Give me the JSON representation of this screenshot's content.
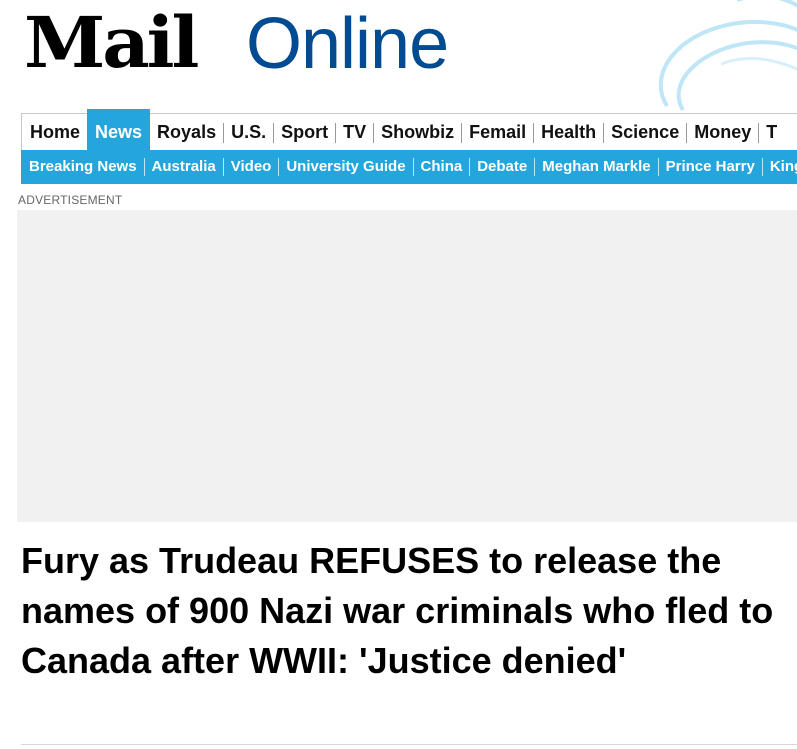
{
  "header": {
    "logo_mail": "Mail",
    "logo_online": "Online"
  },
  "nav_primary": {
    "items": [
      {
        "label": "Home",
        "active": false
      },
      {
        "label": "News",
        "active": true
      },
      {
        "label": "Royals",
        "active": false
      },
      {
        "label": "U.S.",
        "active": false
      },
      {
        "label": "Sport",
        "active": false
      },
      {
        "label": "TV",
        "active": false
      },
      {
        "label": "Showbiz",
        "active": false
      },
      {
        "label": "Femail",
        "active": false
      },
      {
        "label": "Health",
        "active": false
      },
      {
        "label": "Science",
        "active": false
      },
      {
        "label": "Money",
        "active": false
      },
      {
        "label": "T",
        "active": false
      }
    ]
  },
  "nav_secondary": {
    "items": [
      {
        "label": "Breaking News"
      },
      {
        "label": "Australia"
      },
      {
        "label": "Video"
      },
      {
        "label": "University Guide"
      },
      {
        "label": "China"
      },
      {
        "label": "Debate"
      },
      {
        "label": "Meghan Markle"
      },
      {
        "label": "Prince Harry"
      },
      {
        "label": "King"
      }
    ]
  },
  "ad": {
    "label": "ADVERTISEMENT"
  },
  "article": {
    "headline": "Fury as Trudeau REFUSES to release the names of 900 Nazi war criminals who fled to Canada after WWII: 'Justice denied'"
  },
  "colors": {
    "accent": "#24a6dc",
    "logo_online": "#004b91",
    "ad_background": "#f1f1f1"
  }
}
